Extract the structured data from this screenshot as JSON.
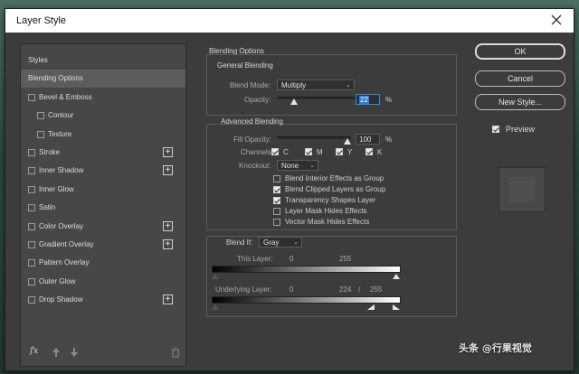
{
  "window": {
    "title": "Layer Style"
  },
  "effects": {
    "items": [
      {
        "label": "Styles",
        "has_checkbox": false,
        "has_plus": false,
        "selected": false
      },
      {
        "label": "Blending Options",
        "has_checkbox": false,
        "has_plus": false,
        "selected": true
      },
      {
        "label": "Bevel & Emboss",
        "has_checkbox": true,
        "has_plus": false,
        "selected": false
      },
      {
        "label": "Contour",
        "has_checkbox": true,
        "has_plus": false,
        "selected": false,
        "indent": true
      },
      {
        "label": "Texture",
        "has_checkbox": true,
        "has_plus": false,
        "selected": false,
        "indent": true
      },
      {
        "label": "Stroke",
        "has_checkbox": true,
        "has_plus": true,
        "selected": false
      },
      {
        "label": "Inner Shadow",
        "has_checkbox": true,
        "has_plus": true,
        "selected": false
      },
      {
        "label": "Inner Glow",
        "has_checkbox": true,
        "has_plus": false,
        "selected": false
      },
      {
        "label": "Satin",
        "has_checkbox": true,
        "has_plus": false,
        "selected": false
      },
      {
        "label": "Color Overlay",
        "has_checkbox": true,
        "has_plus": true,
        "selected": false
      },
      {
        "label": "Gradient Overlay",
        "has_checkbox": true,
        "has_plus": true,
        "selected": false
      },
      {
        "label": "Pattern Overlay",
        "has_checkbox": true,
        "has_plus": false,
        "selected": false
      },
      {
        "label": "Outer Glow",
        "has_checkbox": true,
        "has_plus": false,
        "selected": false
      },
      {
        "label": "Drop Shadow",
        "has_checkbox": true,
        "has_plus": true,
        "selected": false
      }
    ],
    "footer": {
      "fx_label": "fx"
    }
  },
  "blending": {
    "title": "Blending Options",
    "general": {
      "title": "General Blending",
      "blend_mode_label": "Blend Mode:",
      "blend_mode_value": "Multiply",
      "opacity_label": "Opacity:",
      "opacity_value": "22",
      "opacity_unit": "%",
      "opacity_level": 0.22
    },
    "advanced": {
      "title": "Advanced Blending",
      "fill_opacity_label": "Fill Opacity:",
      "fill_opacity_value": "100",
      "fill_opacity_unit": "%",
      "channels_label": "Channels:",
      "channels": [
        {
          "label": "C",
          "checked": true
        },
        {
          "label": "M",
          "checked": true
        },
        {
          "label": "Y",
          "checked": true
        },
        {
          "label": "K",
          "checked": true
        }
      ],
      "knockout_label": "Knockout:",
      "knockout_value": "None",
      "options": [
        {
          "label": "Blend Interior Effects as Group",
          "checked": false
        },
        {
          "label": "Blend Clipped Layers as Group",
          "checked": true
        },
        {
          "label": "Transparency Shapes Layer",
          "checked": true
        },
        {
          "label": "Layer Mask Hides Effects",
          "checked": false
        },
        {
          "label": "Vector Mask Hides Effects",
          "checked": false
        }
      ]
    },
    "blend_if": {
      "label": "Blend If:",
      "value": "Gray",
      "this_layer_label": "This Layer:",
      "this_layer_low": "0",
      "this_layer_high": "255",
      "underlying_label": "Underlying Layer:",
      "underlying_low": "0",
      "underlying_high_a": "224",
      "underlying_sep": "/",
      "underlying_high_b": "255"
    }
  },
  "buttons": {
    "ok": "OK",
    "cancel": "Cancel",
    "new_style": "New Style...",
    "preview_label": "Preview",
    "preview_checked": true
  },
  "watermark": "头条 @行果视觉"
}
